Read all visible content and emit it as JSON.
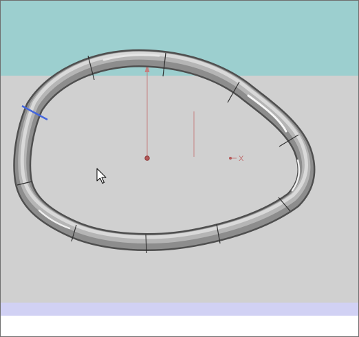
{
  "viewport": {
    "colors": {
      "sky": "#9ccfcf",
      "ground": "#d0d0d0",
      "status_band": "#d1d1f4",
      "tube_dark": "#555555",
      "tube_mid": "#8b8b8b",
      "tube_light": "#c9c9c9",
      "tube_highlight": "#f4f4f4",
      "seam": "#2f2f2f",
      "selected_edge": "#4466dd",
      "axis": "#b07070"
    },
    "axis": {
      "x_label": "X"
    },
    "cursor": {
      "icon": "arrow-cursor-icon"
    }
  }
}
